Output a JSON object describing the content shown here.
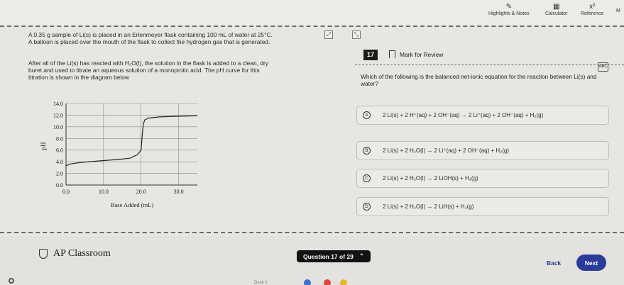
{
  "toolbar": {
    "highlights_label": "Highlights & Notes",
    "calculator_label": "Calculator",
    "reference_label": "Reference",
    "more_label": "M"
  },
  "passage": {
    "para1_line1": "A 0.35 g sample of Li(s) is placed in an Erlenmeyer flask containing 100 mL of water at 25°C.",
    "para1_line2": "A balloon is placed over the mouth of the flask to collect the hydrogen gas that is generated.",
    "para2_line1": "After all of the Li(s) has reacted with H₂O(l), the solution in the flask is added to a clean, dry",
    "para2_line2": "buret and used to titrate an aqueous solution of a monoprotic acid. The pH curve for this",
    "para2_line3": "titration is shown in the diagram below"
  },
  "chart_data": {
    "type": "line",
    "xlabel": "Base Added (mL)",
    "ylabel": "pH",
    "x_ticks": [
      "0.0",
      "10.0",
      "20.0",
      "30.0"
    ],
    "y_ticks": [
      "14.0",
      "12.0",
      "10.0",
      "8.0",
      "6.0",
      "4.0",
      "2.0",
      "0.0"
    ],
    "xlim": [
      0,
      35
    ],
    "ylim": [
      0,
      14
    ],
    "grid": true,
    "series": [
      {
        "x": [
          0,
          1,
          3,
          6,
          10,
          14,
          17,
          19,
          20,
          20.3,
          20.6,
          21,
          22,
          25,
          29,
          35
        ],
        "y": [
          3.3,
          3.6,
          3.8,
          4.0,
          4.2,
          4.4,
          4.6,
          5.2,
          6.0,
          8.5,
          10.5,
          11.2,
          11.5,
          11.7,
          11.8,
          11.9
        ]
      }
    ]
  },
  "question": {
    "number": "17",
    "mark_label": "Mark for Review",
    "abc_label": "ABC",
    "prompt_line1": "Which of the following is the balanced net-ionic equation for the reaction between Li(s) and",
    "prompt_line2": "water?"
  },
  "choices": [
    {
      "letter": "A",
      "text": "2 Li(s) + 2 H⁺(aq) + 2 OH⁻(aq) → 2 Li⁺(aq) + 2 OH⁻(aq) + H₂(g)"
    },
    {
      "letter": "B",
      "text": "2 Li(s) + 2 H₂O(l) → 2 Li⁺(aq) + 2 OH⁻(aq) + H₂(g)"
    },
    {
      "letter": "C",
      "text": "2 Li(s) + 2 H₂O(l) → 2 LiOH(s) + H₂(g)"
    },
    {
      "letter": "D",
      "text": "2 Li(s) + 2 H₂O(l) → 2 LiH(s) + H₂(g)"
    }
  ],
  "footer": {
    "brand": "AP Classroom",
    "question_counter": "Question 17 of 29",
    "back_label": "Back",
    "next_label": "Next",
    "taskbar_text": "Desk 1"
  }
}
